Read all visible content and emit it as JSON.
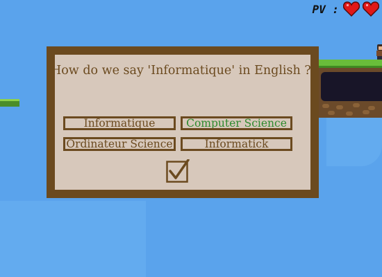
{
  "hud": {
    "label": "PV :",
    "lives": 2
  },
  "quiz": {
    "question": "How do we say 'Informatique' in English ?",
    "answers": [
      {
        "text": "Informatique",
        "correct": false
      },
      {
        "text": "Computer Science",
        "correct": true
      },
      {
        "text": "Ordinateur Science",
        "correct": false
      },
      {
        "text": "Informatick",
        "correct": false
      }
    ],
    "confirm_icon": "checkmark-icon"
  },
  "colors": {
    "sky": "#5aa3ec",
    "frame": "#6b4a1f",
    "panel": "#d7c8bb",
    "correct_answer": "#2e8a2e",
    "heart": "#e01818"
  }
}
